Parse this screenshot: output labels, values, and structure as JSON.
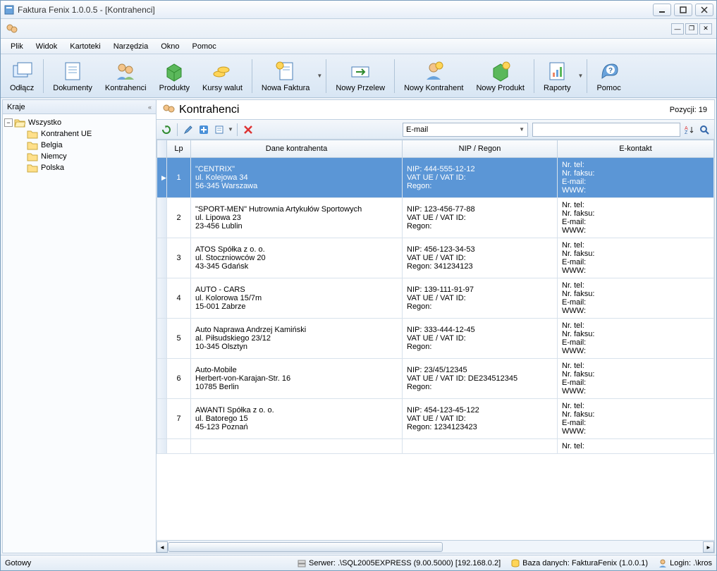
{
  "window": {
    "title": "Faktura Fenix 1.0.0.5 - [Kontrahenci]"
  },
  "menu": [
    "Plik",
    "Widok",
    "Kartoteki",
    "Narzędzia",
    "Okno",
    "Pomoc"
  ],
  "toolbar": [
    {
      "label": "Odłącz",
      "icon": "detach"
    },
    {
      "label": "Dokumenty",
      "icon": "docs"
    },
    {
      "label": "Kontrahenci",
      "icon": "people"
    },
    {
      "label": "Produkty",
      "icon": "box"
    },
    {
      "label": "Kursy walut",
      "icon": "coins"
    },
    {
      "label": "Nowa Faktura",
      "icon": "newdoc",
      "drop": true
    },
    {
      "label": "Nowy Przelew",
      "icon": "transfer"
    },
    {
      "label": "Nowy Kontrahent",
      "icon": "newperson"
    },
    {
      "label": "Nowy Produkt",
      "icon": "newbox"
    },
    {
      "label": "Raporty",
      "icon": "chart",
      "drop": true
    },
    {
      "label": "Pomoc",
      "icon": "help"
    }
  ],
  "sidebar": {
    "header": "Kraje",
    "root": "Wszystko",
    "children": [
      "Kontrahent UE",
      "Belgia",
      "Niemcy",
      "Polska"
    ]
  },
  "content": {
    "title": "Kontrahenci",
    "count_label": "Pozycji: 19"
  },
  "filter": {
    "select_value": "E-mail",
    "input_value": ""
  },
  "grid": {
    "columns": [
      "Lp",
      "Dane kontrahenta",
      "NIP / Regon",
      "E-kontakt"
    ],
    "rows": [
      {
        "lp": "1",
        "selected": true,
        "dane": "\"CENTRIX\"\nul. Kolejowa 34\n56-345 Warszawa",
        "nip": "NIP: 444-555-12-12\nVAT UE / VAT ID:\nRegon:",
        "ek": "Nr. tel:\nNr. faksu:\nE-mail:\nWWW:"
      },
      {
        "lp": "2",
        "dane": "\"SPORT-MEN\" Hutrownia Artykułów Sportowych\nul. Lipowa 23\n23-456 Lublin",
        "nip": "NIP: 123-456-77-88\nVAT UE / VAT ID:\nRegon:",
        "ek": "Nr. tel:\nNr. faksu:\nE-mail:\nWWW:"
      },
      {
        "lp": "3",
        "dane": "ATOS Spółka z o. o.\nul. Stoczniowców 20\n43-345 Gdańsk",
        "nip": "NIP: 456-123-34-53\nVAT UE / VAT ID:\nRegon: 341234123",
        "ek": "Nr. tel:\nNr. faksu:\nE-mail:\nWWW:"
      },
      {
        "lp": "4",
        "dane": "AUTO - CARS\nul. Kolorowa 15/7m\n15-001 Zabrze",
        "nip": "NIP: 139-111-91-97\nVAT UE / VAT ID:\nRegon:",
        "ek": "Nr. tel:\nNr. faksu:\nE-mail:\nWWW:"
      },
      {
        "lp": "5",
        "dane": "Auto Naprawa Andrzej Kamiński\nal. Piłsudskiego 23/12\n10-345 Olsztyn",
        "nip": "NIP: 333-444-12-45\nVAT UE / VAT ID:\nRegon:",
        "ek": "Nr. tel:\nNr. faksu:\nE-mail:\nWWW:"
      },
      {
        "lp": "6",
        "dane": "Auto-Mobile\nHerbert-von-Karajan-Str. 16\n10785 Berlin",
        "nip": "NIP: 23/45/12345\nVAT UE / VAT ID: DE234512345\nRegon:",
        "ek": "Nr. tel:\nNr. faksu:\nE-mail:\nWWW:"
      },
      {
        "lp": "7",
        "dane": "AWANTI Spółka z o. o.\nul. Batorego 15\n45-123 Poznań",
        "nip": "NIP: 454-123-45-122\nVAT UE / VAT ID:\nRegon: 1234123423",
        "ek": "Nr. tel:\nNr. faksu:\nE-mail:\nWWW:"
      }
    ],
    "partial_last": "Nr. tel:"
  },
  "status": {
    "ready": "Gotowy",
    "server": "Serwer: .\\SQL2005EXPRESS (9.00.5000) [192.168.0.2]",
    "db": "Baza danych: FakturaFenix (1.0.0.1)",
    "login": "Login: .\\kros"
  }
}
